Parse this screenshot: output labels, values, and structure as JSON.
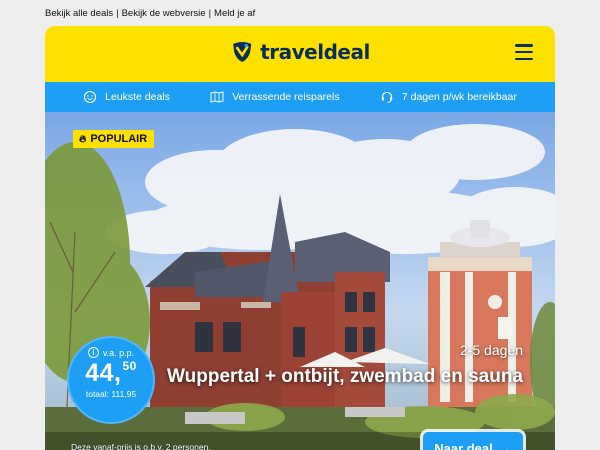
{
  "top_links": {
    "all_deals": "Bekijk alle deals",
    "web_version": "Bekijk de webversie",
    "unsubscribe": "Meld je af",
    "separator": "|"
  },
  "header": {
    "logo_text": "traveldeal",
    "logo_icon": "traveldeal-logo-icon",
    "menu_icon": "hamburger-menu-icon",
    "background": "#ffe100",
    "brand_color": "#0b2e59"
  },
  "usp_bar": {
    "background": "#1c9ff5",
    "items": [
      {
        "icon": "smiley-icon",
        "label": "Leukste deals"
      },
      {
        "icon": "world-map-icon",
        "label": "Verrassende reisparels"
      },
      {
        "icon": "headset-icon",
        "label": "7 dagen p/wk bereikbaar"
      }
    ]
  },
  "deal": {
    "badge": "POPULAIR",
    "badge_icon": "flame-icon",
    "price_prefix": "v.a. p.p.",
    "price_whole": "44,",
    "price_cents": "50",
    "price_total": "totaal: 111,95",
    "duration": "2-5 dagen",
    "title": "Wuppertal + ontbijt, zwembad en sauna",
    "footnote": "Deze vanaf-prijs is o.b.v. 2 personen.",
    "cta_label": "Naar deal",
    "cta_icon": "arrow-right-icon",
    "accent": "#1c9ff5"
  }
}
